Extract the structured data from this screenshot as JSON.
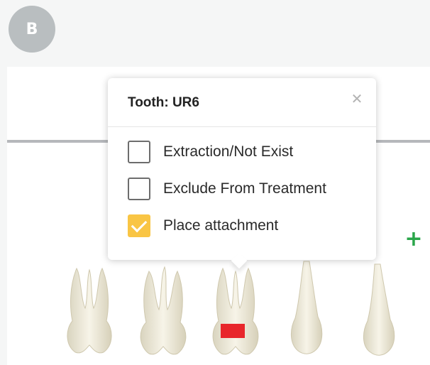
{
  "panel": {
    "label": "B"
  },
  "popover": {
    "title": "Tooth: UR6",
    "close_icon": "close-icon",
    "options": [
      {
        "label": "Extraction/Not Exist",
        "checked": false
      },
      {
        "label": "Exclude From Treatment",
        "checked": false
      },
      {
        "label": "Place attachment",
        "checked": true
      }
    ]
  },
  "add_button": {
    "icon": "plus-icon",
    "glyph": "+"
  },
  "close_glyph": "✕",
  "colors": {
    "panel_badge": "#b9bec0",
    "checkbox_checked": "#f9c544",
    "attachment_marker": "#e8262b",
    "add_icon": "#2aa64a",
    "tooth_fill": "#f3f0e3"
  }
}
